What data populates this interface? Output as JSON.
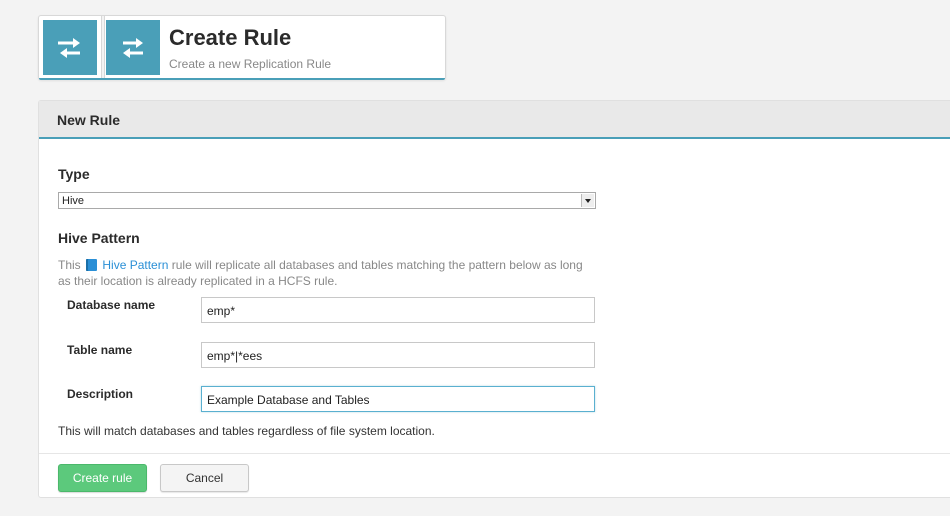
{
  "header": {
    "title": "Create Rule",
    "subtitle": "Create a new Replication Rule",
    "icon": "replication-arrows-icon",
    "accent_color": "#4a9fb8"
  },
  "panel": {
    "title": "New Rule"
  },
  "type_section": {
    "label": "Type",
    "selected": "Hive"
  },
  "pattern_section": {
    "label": "Hive Pattern",
    "desc_prefix": "This",
    "desc_link": "Hive Pattern",
    "desc_suffix": "rule will replicate all databases and tables matching the pattern below as long as their location is already replicated in a HCFS rule."
  },
  "fields": {
    "database_label": "Database name",
    "database_value": "emp*",
    "table_label": "Table name",
    "table_value": "emp*|*ees",
    "description_label": "Description",
    "description_value": "Example Database and Tables"
  },
  "note": "This will match databases and tables regardless of file system location.",
  "buttons": {
    "create": "Create rule",
    "cancel": "Cancel",
    "create_color": "#5cc97c"
  }
}
